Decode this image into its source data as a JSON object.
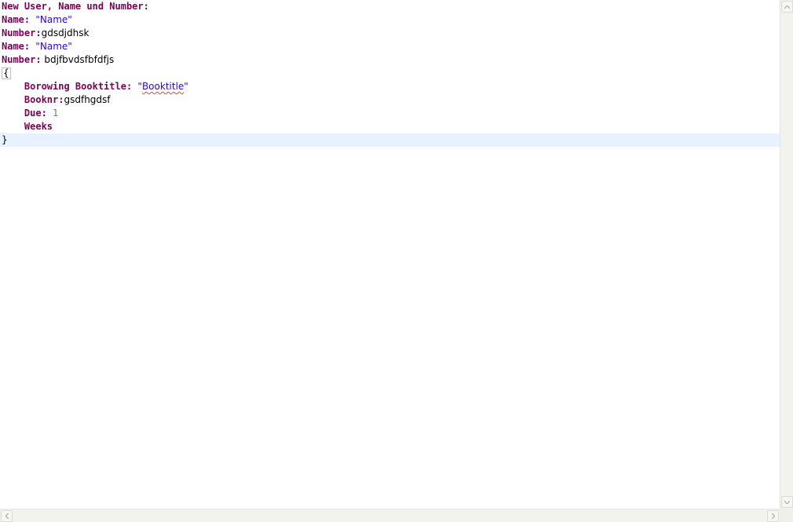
{
  "editor": {
    "line1": {
      "kw": "New User, Name und Number:"
    },
    "line2": {
      "kw": "Name:",
      "sep": " ",
      "str": "\"Name\""
    },
    "line3": {
      "kw": "Number:",
      "value": "gdsdjdhsk"
    },
    "line4": {
      "kw": "Name:",
      "sep": " ",
      "str": "\"Name\""
    },
    "line5": {
      "kw": "Number:",
      "value": " bdjfbvdsfbfdfjs"
    },
    "line6": {
      "bracket": "{"
    },
    "line7": {
      "indent": "    ",
      "kw": "Borowing Booktitle:",
      "sep": " ",
      "q1": "\"",
      "str": "Booktitle",
      "q2": "\""
    },
    "line8": {
      "indent": "    ",
      "kw": "Booknr:",
      "value": "gsdfhgdsf"
    },
    "line9": {
      "indent": "    ",
      "kw": "Due:",
      "sep": " ",
      "num": "1"
    },
    "line10": {
      "indent": "    ",
      "kw": "Weeks"
    },
    "line11": {
      "bracket": "}"
    }
  },
  "colors": {
    "keyword": "#7f0055",
    "string": "#2a00ff",
    "number": "#7a7a7a",
    "current_line": "#e8f2fe"
  },
  "icons": {
    "scroll_up": "up-arrow-icon",
    "scroll_down": "down-arrow-icon",
    "scroll_left": "left-arrow-icon",
    "scroll_right": "right-arrow-icon"
  }
}
